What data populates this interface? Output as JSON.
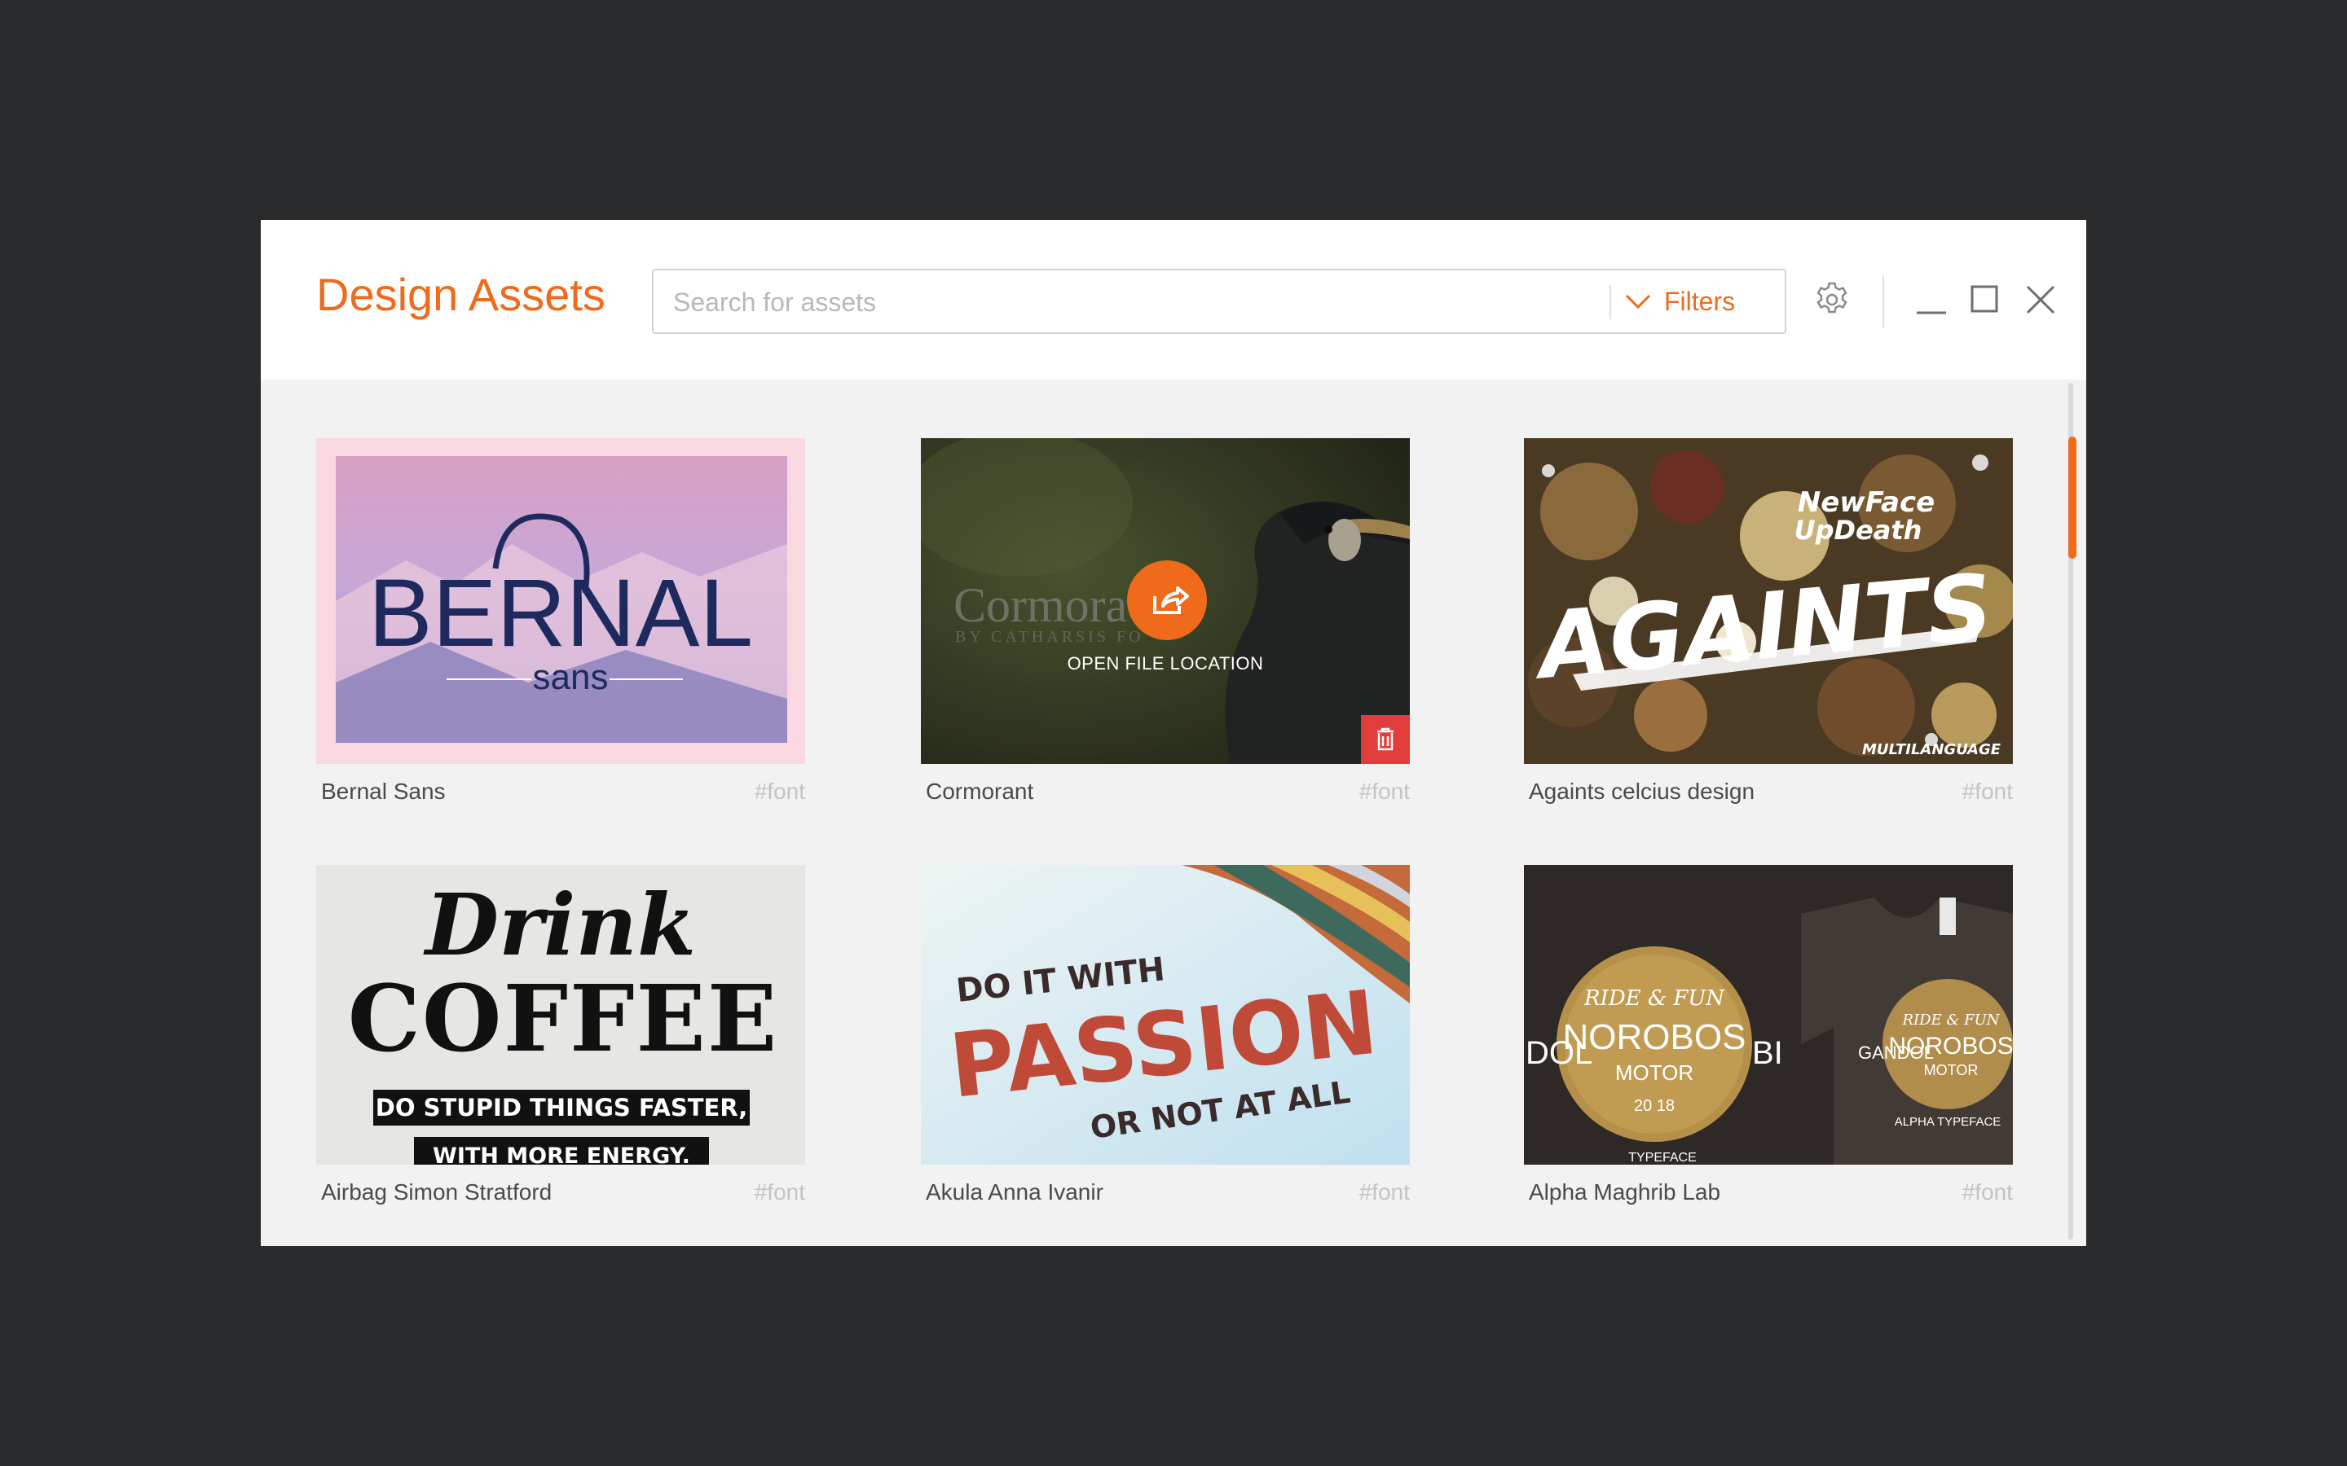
{
  "app": {
    "title": "Design Assets"
  },
  "search": {
    "placeholder": "Search for assets",
    "value": ""
  },
  "filters": {
    "label": "Filters",
    "icon": "chevron-down-icon"
  },
  "icons": {
    "settings": "gear-icon",
    "minimize": "minimize-icon",
    "maximize": "maximize-icon",
    "close": "close-icon"
  },
  "colors": {
    "accent": "#ef6a1b",
    "delete": "#e23d3d",
    "background": "#2a2b2d",
    "panel": "#f2f2f2"
  },
  "overlay": {
    "action_label": "OPEN FILE LOCATION"
  },
  "assets": [
    {
      "name": "Bernal Sans",
      "tag": "#font",
      "preview_text": [
        "BERNAL",
        "sans"
      ]
    },
    {
      "name": "Cormorant",
      "tag": "#font",
      "preview_text": [
        "Cormora",
        "BY CATHARSIS FO"
      ]
    },
    {
      "name": "Againts celcius design",
      "tag": "#font",
      "preview_text": [
        "NewFace",
        "UpDeath",
        "AGAINTS",
        "MULTILANGUAGE"
      ]
    },
    {
      "name": "Airbag Simon Stratford",
      "tag": "#font",
      "preview_text": [
        "Drink",
        "COFFEE",
        "DO STUPID THINGS FASTER,",
        "WITH MORE ENERGY."
      ]
    },
    {
      "name": "Akula Anna Ivanir",
      "tag": "#font",
      "preview_text": [
        "DO IT WITH",
        "PASSION",
        "OR NOT AT ALL"
      ]
    },
    {
      "name": "Alpha Maghrib Lab",
      "tag": "#font",
      "preview_text": [
        "RIDE & FUN",
        "NOROBOS",
        "MOTOR",
        "20 18",
        "DOL",
        "BI",
        "GANDOL",
        "RIDE & FUN",
        "NOROBOS",
        "MOTOR",
        "ALPHA TYPEFACE",
        "TYPEFACE"
      ]
    }
  ]
}
